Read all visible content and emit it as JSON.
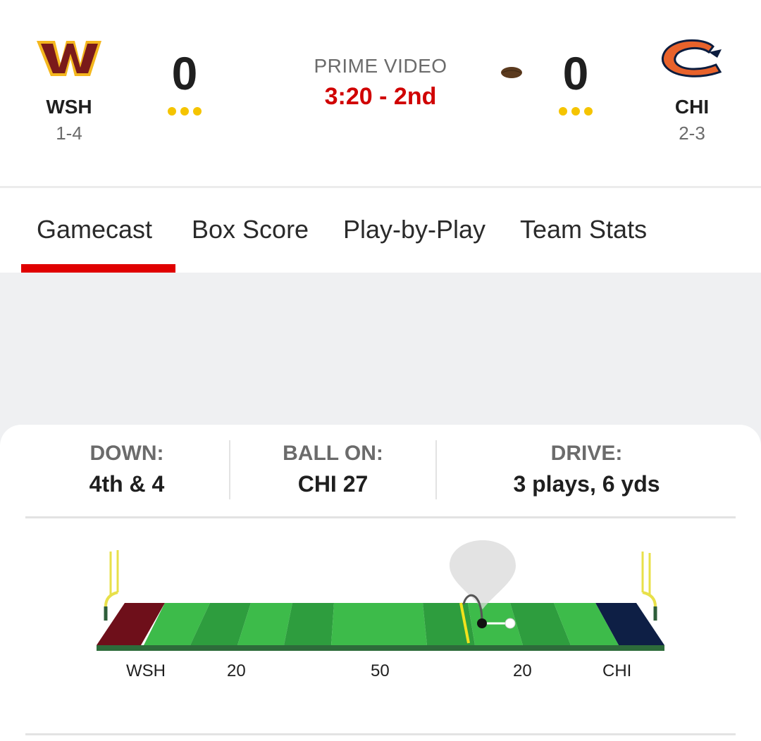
{
  "header": {
    "home": {
      "abbr": "WSH",
      "record": "1-4",
      "score": "0",
      "logo_icon": "commanders-w-logo",
      "color": "#5a1414"
    },
    "away": {
      "abbr": "CHI",
      "record": "2-3",
      "score": "0",
      "logo_icon": "bears-c-logo",
      "color": "#0b1c3e"
    },
    "broadcast": "PRIME VIDEO",
    "clock": "3:20 - 2nd",
    "possession_icon": "football-icon",
    "possession_team": "CHI"
  },
  "tabs": [
    {
      "label": "Gamecast",
      "active": true
    },
    {
      "label": "Box Score",
      "active": false
    },
    {
      "label": "Play-by-Play",
      "active": false
    },
    {
      "label": "Team Stats",
      "active": false
    }
  ],
  "situation": {
    "down_label": "DOWN:",
    "down_value": "4th & 4",
    "ball_on_label": "BALL ON:",
    "ball_on_value": "CHI 27",
    "drive_label": "DRIVE:",
    "drive_value": "3 plays, 6 yds"
  },
  "field": {
    "labels": {
      "left_endzone": "WSH",
      "left_20": "20",
      "midfield": "50",
      "right_20": "20",
      "right_endzone": "CHI"
    },
    "ball_on_yard": "CHI 27",
    "first_down_marker": "CHI 23",
    "colors": {
      "turf_light": "#3dbb4a",
      "turf_dark": "#2e9d3e",
      "first_down_line": "#f0e21d",
      "goalpost": "#e8e04a"
    }
  },
  "colors": {
    "accent": "#e00000",
    "clock": "#d00000",
    "timeout_dot": "#f5c400"
  }
}
